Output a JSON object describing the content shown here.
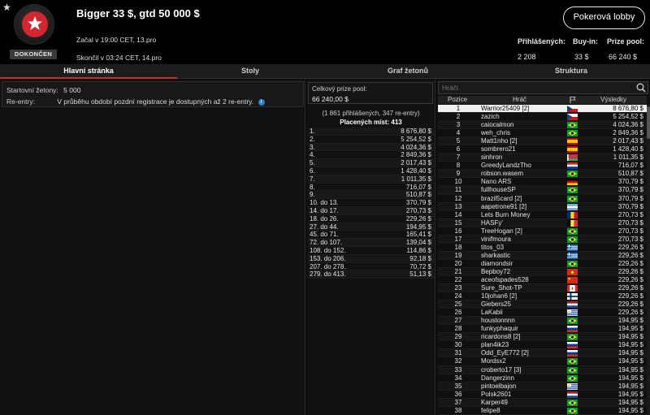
{
  "header": {
    "title": "Bigger 33 $, gtd 50 000 $",
    "status": "DOKONČEN",
    "started": "Začal v 19:00 CET, 13.pro",
    "finished": "Skončil v 03:24 CET, 14.pro",
    "lobby_button": "Pokerová lobby",
    "stats": [
      {
        "label": "Přihlášených:",
        "value": "2 208"
      },
      {
        "label": "Buy-in:",
        "value": "33 $"
      },
      {
        "label": "Prize pool:",
        "value": "66 240 $"
      }
    ]
  },
  "tabs": [
    "Hlavní stránka",
    "Stoly",
    "Graf žetonů",
    "Struktura"
  ],
  "info": {
    "starting_chips_label": "Startovní žetony:",
    "starting_chips_value": "5 000",
    "reentry_label": "Re-entry:",
    "reentry_value": "V průběhu období pozdní registrace je dostupných až 2 re-entry."
  },
  "prize": {
    "pool_label": "Celkový prize pool:",
    "pool_value": "66 240,00 $",
    "summary": "(1 861 přihlášených, 347 re-entry)",
    "paid_places": "Placených míst: 413",
    "payouts": [
      [
        "1.",
        "8 676,80 $"
      ],
      [
        "2.",
        "5 254,52 $"
      ],
      [
        "3.",
        "4 024,36 $"
      ],
      [
        "4.",
        "2 849,36 $"
      ],
      [
        "5.",
        "2 017,43 $"
      ],
      [
        "6.",
        "1 428,40 $"
      ],
      [
        "7.",
        "1 011,35 $"
      ],
      [
        "8.",
        "716,07 $"
      ],
      [
        "9.",
        "510,87 $"
      ],
      [
        "10. do 13.",
        "370,79 $"
      ],
      [
        "14. do 17.",
        "270,73 $"
      ],
      [
        "18. do 26.",
        "229,26 $"
      ],
      [
        "27. do 44.",
        "194,95 $"
      ],
      [
        "45. do 71.",
        "165,41 $"
      ],
      [
        "72. do 107.",
        "139,04 $"
      ],
      [
        "108. do 152.",
        "114,86 $"
      ],
      [
        "153. do 206.",
        "92,18 $"
      ],
      [
        "207. do 278.",
        "70,72 $"
      ],
      [
        "279. do 413.",
        "51,13 $"
      ]
    ]
  },
  "players": {
    "search_placeholder": "Hráči",
    "columns": {
      "position": "Pozice",
      "player": "Hráč",
      "results": "Výsledky"
    },
    "rows": [
      [
        "1",
        "Warrior25409 [2]",
        "cz",
        "8 676,80 $"
      ],
      [
        "2",
        "zazich",
        "cz",
        "5 254,52 $"
      ],
      [
        "3",
        "caiocalmon",
        "br",
        "4 024,36 $"
      ],
      [
        "4",
        "weh_chris",
        "br",
        "2 849,36 $"
      ],
      [
        "5",
        "Matt1nho [2]",
        "es",
        "2 017,43 $"
      ],
      [
        "6",
        "sombrero21",
        "es",
        "1 428,40 $"
      ],
      [
        "7",
        "sinhron",
        "by",
        "1 011,35 $"
      ],
      [
        "8",
        "GreedyLandzTho",
        "py",
        "716,07 $"
      ],
      [
        "9",
        "robson.wasem",
        "br",
        "510,87 $"
      ],
      [
        "10",
        "Nano ARS",
        "de",
        "370,79 $"
      ],
      [
        "11",
        "fullhouseSP",
        "br",
        "370,79 $"
      ],
      [
        "12",
        "brazil5card [2]",
        "br",
        "370,79 $"
      ],
      [
        "13",
        "aapetrone91 [2]",
        "ar",
        "370,79 $"
      ],
      [
        "14",
        "Lets Burn Money",
        "ro",
        "270,73 $"
      ],
      [
        "15",
        "HASFy'",
        "be",
        "270,73 $"
      ],
      [
        "16",
        "TreeHogan [2]",
        "br",
        "270,73 $"
      ],
      [
        "17",
        "vinifmoura",
        "br",
        "270,73 $"
      ],
      [
        "18",
        "titos_03",
        "gr",
        "229,26 $"
      ],
      [
        "19",
        "sharkastic",
        "gr",
        "229,26 $"
      ],
      [
        "20",
        "diamondsir",
        "br",
        "229,26 $"
      ],
      [
        "21",
        "Bepboy72",
        "vn",
        "229,26 $"
      ],
      [
        "22",
        "aceofspades528",
        "cn",
        "229,26 $"
      ],
      [
        "23",
        "Sure_Shot-TP",
        "ca",
        "229,26 $"
      ],
      [
        "24",
        "10johan6 [2]",
        "fi",
        "229,26 $"
      ],
      [
        "25",
        "Giebers25",
        "nl",
        "229,26 $"
      ],
      [
        "26",
        "LaKabii",
        "uy",
        "229,26 $"
      ],
      [
        "27",
        "houstonnnn",
        "br",
        "194,95 $"
      ],
      [
        "28",
        "funkyphaquir",
        "ru",
        "194,95 $"
      ],
      [
        "29",
        "ricardons8 [2]",
        "br",
        "194,95 $"
      ],
      [
        "30",
        "plan4ik23",
        "ru",
        "194,95 $"
      ],
      [
        "31",
        "Odd_EyE772 [2]",
        "ru",
        "194,95 $"
      ],
      [
        "32",
        "Mordsx2",
        "br",
        "194,95 $"
      ],
      [
        "33",
        "croberto17 [3]",
        "br",
        "194,95 $"
      ],
      [
        "34",
        "Dangerzinn",
        "br",
        "194,95 $"
      ],
      [
        "35",
        "pintoelbajon",
        "uy",
        "194,95 $"
      ],
      [
        "36",
        "Polsk2601",
        "nl",
        "194,95 $"
      ],
      [
        "37",
        "Karper49",
        "br",
        "194,95 $"
      ],
      [
        "38",
        "felipe8",
        "br",
        "194,95 $"
      ]
    ]
  },
  "colors": {
    "accent": "#d22630",
    "info": "#2a7fd0"
  }
}
